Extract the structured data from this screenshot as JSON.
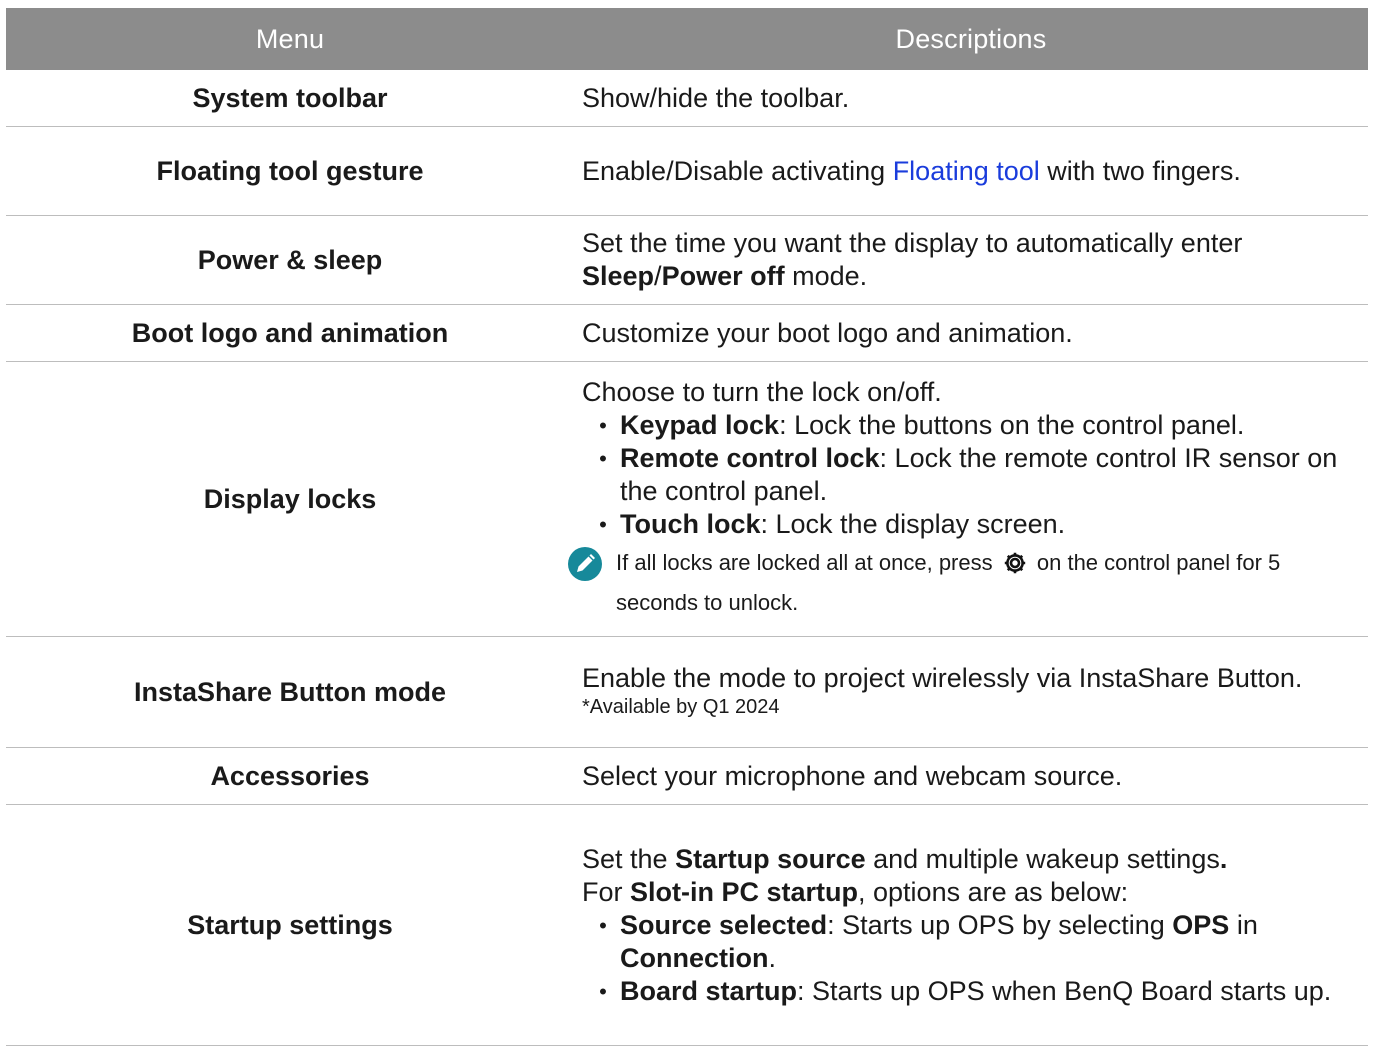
{
  "header": {
    "menu": "Menu",
    "descriptions": "Descriptions"
  },
  "colors": {
    "header_bg": "#8c8c8c",
    "link": "#1a3cdc",
    "note_icon": "#16899a"
  },
  "rows": {
    "system_toolbar": {
      "menu": "System toolbar",
      "desc": "Show/hide the toolbar."
    },
    "floating_gesture": {
      "menu": "Floating tool gesture",
      "desc_pre": "Enable/Disable activating ",
      "desc_link": "Floating tool",
      "desc_post": " with two fingers."
    },
    "power_sleep": {
      "menu": "Power & sleep",
      "desc_pre": "Set the time you want the display to automatically enter ",
      "b1": "Sleep",
      "sep": "/",
      "b2": "Power off",
      "desc_post": " mode."
    },
    "boot_logo": {
      "menu": "Boot logo and animation",
      "desc": "Customize your boot logo and animation."
    },
    "display_locks": {
      "menu": "Display locks",
      "intro": "Choose to turn the lock on/off.",
      "items": [
        {
          "term": "Keypad lock",
          "text": ": Lock the buttons on the control panel."
        },
        {
          "term": "Remote control lock",
          "text": ": Lock the remote control IR sensor on the control panel."
        },
        {
          "term": "Touch lock",
          "text": ": Lock the display screen."
        }
      ],
      "note_pre": "If all locks are locked all at once, press",
      "note_post": "on the control panel for 5 seconds to unlock.",
      "note_icon": "pencil-note-icon",
      "gear_icon": "gear-icon"
    },
    "instashare": {
      "menu": "InstaShare Button mode",
      "desc": "Enable the mode to project wirelessly via InstaShare Button.",
      "avail": "*Available by Q1 2024"
    },
    "accessories": {
      "menu": "Accessories",
      "desc": "Select your microphone and webcam source."
    },
    "startup": {
      "menu": "Startup settings",
      "l1_pre": "Set the ",
      "l1_b": "Startup source",
      "l1_post": " and multiple wakeup settings",
      "l1_dot": ".",
      "l2_pre": "For ",
      "l2_b": "Slot-in PC startup",
      "l2_post": ", options are as below:",
      "item1_term": "Source selected",
      "item1_text": ": Starts up OPS by selecting ",
      "item1_b1": "OPS",
      "item1_mid": " in ",
      "item1_b2": "Connection",
      "item1_end": ".",
      "item2_term": "Board startup",
      "item2_text": ": Starts up OPS when BenQ Board starts up."
    }
  }
}
